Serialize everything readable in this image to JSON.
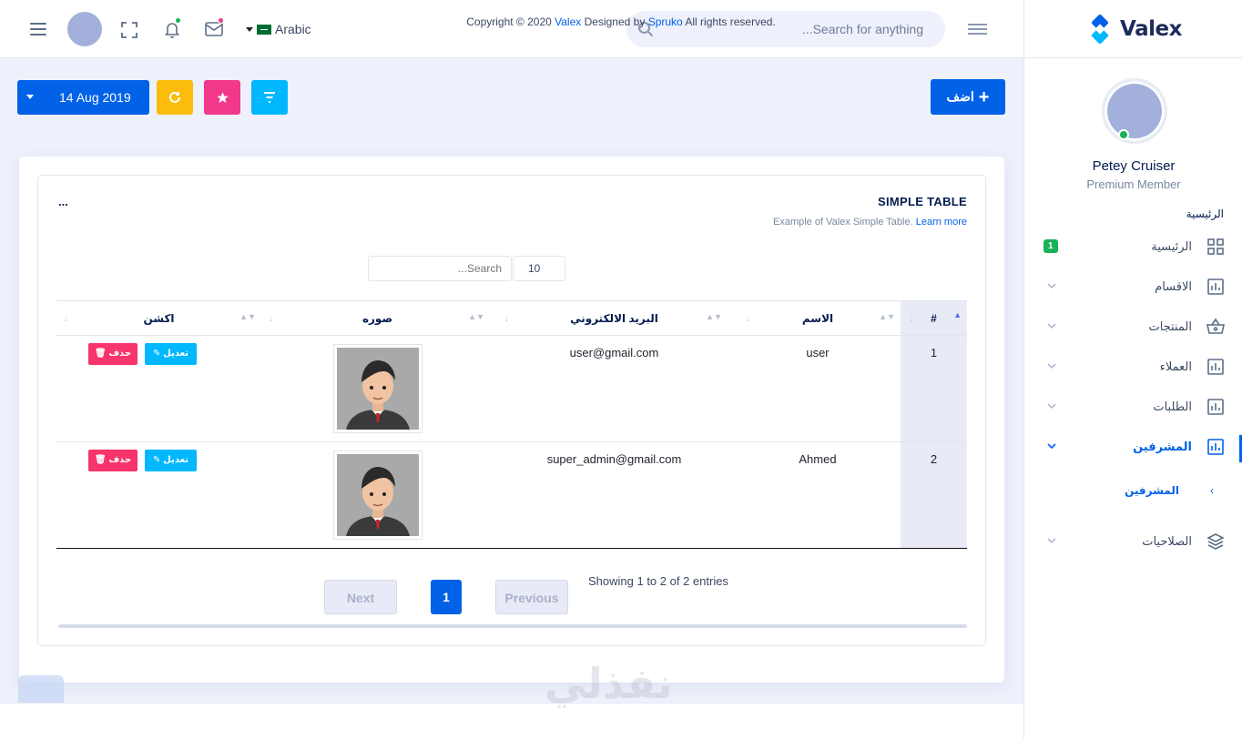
{
  "header": {
    "language": "Arabic",
    "search_placeholder": "...Search for anything",
    "colors": {
      "bell_dot": "#19b159",
      "mail_dot": "#f1388b"
    }
  },
  "sidebar": {
    "brand": "Valex",
    "profile": {
      "name": "Petey Cruiser",
      "role": "Premium Member"
    },
    "section_label": "الرئيسية",
    "items": [
      {
        "label": "الرئيسية",
        "icon": "dashboard-icon",
        "badge": "1"
      },
      {
        "label": "الاقسام",
        "icon": "chart-icon"
      },
      {
        "label": "المنتجات",
        "icon": "basket-icon"
      },
      {
        "label": "العملاء",
        "icon": "chart-icon"
      },
      {
        "label": "الطلبات",
        "icon": "chart-icon"
      },
      {
        "label": "المشرفين",
        "icon": "chart-icon",
        "active": true
      },
      {
        "label": "الصلاحيات",
        "icon": "layers-icon"
      }
    ],
    "sub_items": [
      {
        "label": "المشرفين"
      }
    ]
  },
  "toolbar": {
    "date_label": "14 Aug 2019",
    "add_label": "اضف",
    "colors": {
      "primary": "#0162e8",
      "warning": "#fbbc0b",
      "pink": "#f1388b",
      "info": "#01b8ff"
    }
  },
  "card": {
    "title": "SIMPLE TABLE",
    "subtitle": "Example of Valex Simple Table.",
    "learn_more": "Learn more",
    "menu": "..."
  },
  "table": {
    "search_placeholder": "...Search",
    "page_length": "10",
    "columns": [
      "#",
      "الاسم",
      "البريد الالكتروني",
      "صوره",
      "اكشن"
    ],
    "rows": [
      {
        "num": "1",
        "name": "user",
        "email": "user@gmail.com",
        "edit": "تعديل",
        "delete": "حذف"
      },
      {
        "num": "2",
        "name": "Ahmed",
        "email": "super_admin@gmail.com",
        "edit": "تعديل",
        "delete": "حذف"
      }
    ],
    "info": "Showing 1 to 2 of 2 entries",
    "pagination": {
      "previous": "Previous",
      "current": "1",
      "next": "Next"
    }
  },
  "footer": {
    "text_prefix": "Copyright © 2020",
    "brand": "Valex",
    "designed_by": "Designed by",
    "author": "Spruko",
    "suffix": "All rights reserved."
  },
  "watermark": "نفذلي"
}
